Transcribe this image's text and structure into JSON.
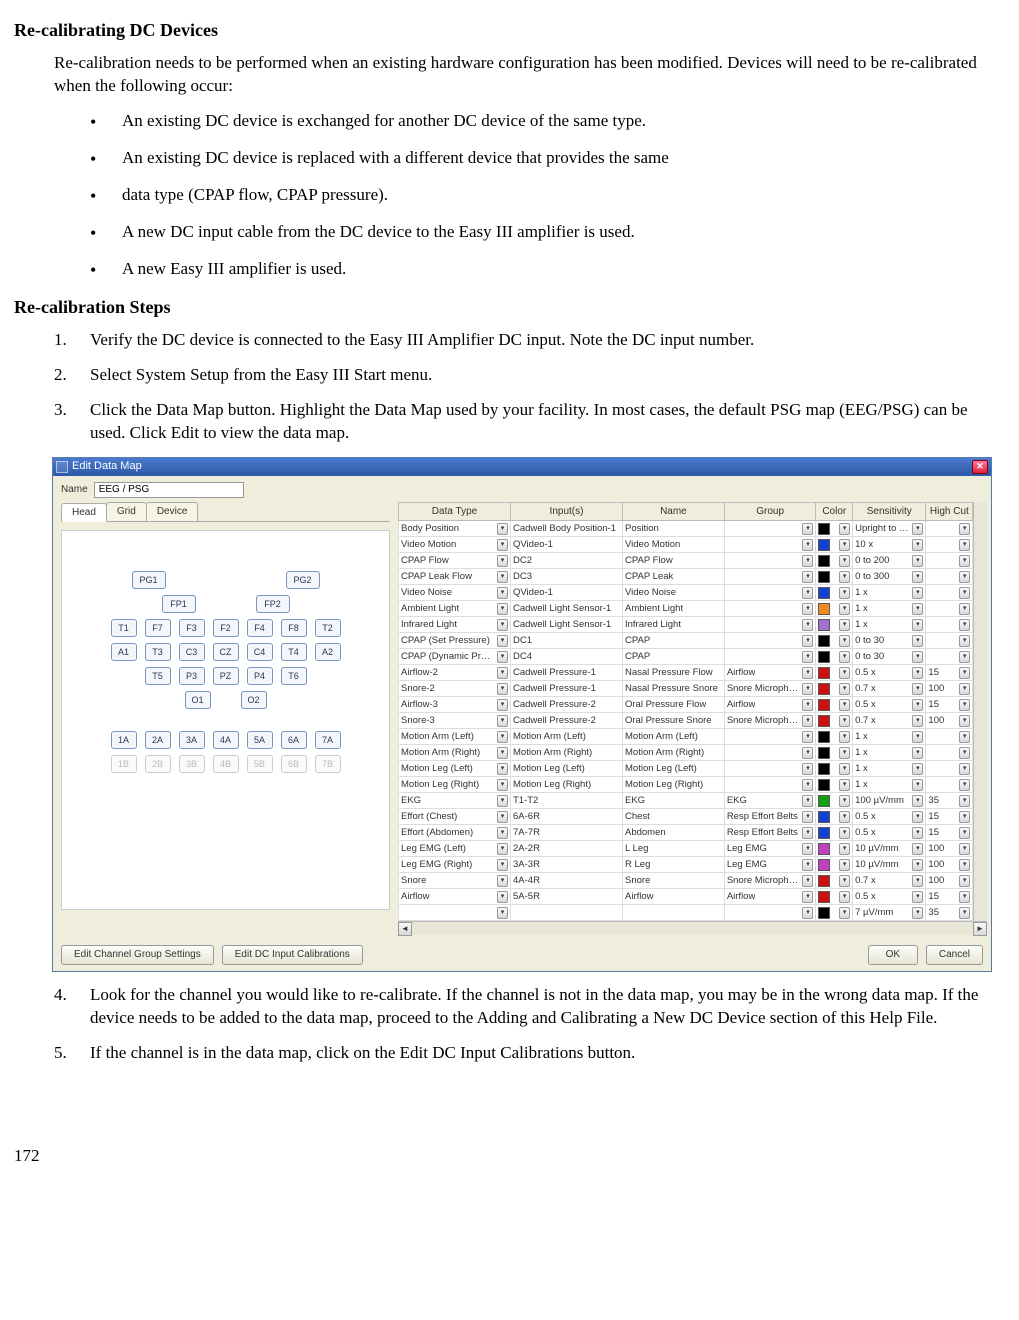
{
  "page_number": "172",
  "h1": "Re-calibrating DC Devices",
  "intro": "Re-calibration needs to be performed when an existing hardware configuration has been modified.  Devices will need to be re-calibrated when the following occur:",
  "bullets": [
    "An existing DC device is exchanged for another DC device of the same type.",
    "An existing DC device is replaced with a different device that provides the same",
    "data type (CPAP flow, CPAP pressure).",
    "A new DC input cable from the DC device to the Easy III amplifier is used.",
    "A new Easy III amplifier is used."
  ],
  "h2": "Re-calibration Steps",
  "steps": [
    "Verify the DC device is connected to the Easy III Amplifier DC input.  Note the DC  input number.",
    "Select System Setup from the Easy III Start menu.",
    "Click the Data Map button.  Highlight the Data Map used by your facility.  In most cases, the default PSG map (EEG/PSG) can be used.  Click Edit to view the data map.",
    "Look for the channel you would like to re-calibrate.  If the channel is not in the data map, you may be in the wrong data map.  If the device needs to be added to the data map, proceed to the Adding and Calibrating a New DC Device section of this Help File.",
    "If the channel is in the data map, click on the Edit DC Input Calibrations button."
  ],
  "win": {
    "title": "Edit Data Map",
    "name_label": "Name",
    "name_value": "EEG / PSG",
    "tabs": [
      "Head",
      "Grid",
      "Device"
    ],
    "headers": [
      "Data Type",
      "Input(s)",
      "Name",
      "Group",
      "Color",
      "Sensitivity",
      "High Cut"
    ],
    "buttons": {
      "edit_group": "Edit Channel Group Settings",
      "edit_dc": "Edit DC Input Calibrations",
      "ok": "OK",
      "cancel": "Cancel"
    },
    "electrodes": {
      "r1": [
        "PG1",
        "PG2"
      ],
      "r2": [
        "FP1",
        "FP2"
      ],
      "r3": [
        "T1",
        "F7",
        "F3",
        "F2",
        "F4",
        "F8",
        "T2"
      ],
      "r4": [
        "A1",
        "T3",
        "C3",
        "CZ",
        "C4",
        "T4",
        "A2"
      ],
      "r5": [
        "T5",
        "P3",
        "PZ",
        "P4",
        "T6"
      ],
      "r6": [
        "O1",
        "O2"
      ],
      "r7": [
        "1A",
        "2A",
        "3A",
        "4A",
        "5A",
        "6A",
        "7A"
      ],
      "r8": [
        "1B",
        "2B",
        "3B",
        "4B",
        "5B",
        "6B",
        "7B"
      ]
    },
    "rows": [
      {
        "dt": "Body Position",
        "in": "Cadwell Body Position-1",
        "nm": "Position",
        "gp": "",
        "col": "#000000",
        "sen": "Upright to Left",
        "hc": ""
      },
      {
        "dt": "Video Motion",
        "in": "QVideo-1",
        "nm": "Video Motion",
        "gp": "",
        "col": "#1040d0",
        "sen": "10 x",
        "hc": ""
      },
      {
        "dt": "CPAP Flow",
        "in": "DC2",
        "nm": "CPAP Flow",
        "gp": "",
        "col": "#000000",
        "sen": "0 to 200",
        "hc": ""
      },
      {
        "dt": "CPAP Leak Flow",
        "in": "DC3",
        "nm": "CPAP Leak",
        "gp": "",
        "col": "#000000",
        "sen": "0 to 300",
        "hc": ""
      },
      {
        "dt": "Video Noise",
        "in": "QVideo-1",
        "nm": "Video Noise",
        "gp": "",
        "col": "#1040d0",
        "sen": "1 x",
        "hc": ""
      },
      {
        "dt": "Ambient Light",
        "in": "Cadwell Light Sensor-1",
        "nm": "Ambient Light",
        "gp": "",
        "col": "#ef8a1f",
        "sen": "1 x",
        "hc": ""
      },
      {
        "dt": "Infrared Light",
        "in": "Cadwell Light Sensor-1",
        "nm": "Infrared Light",
        "gp": "",
        "col": "#a070d0",
        "sen": "1 x",
        "hc": ""
      },
      {
        "dt": "CPAP (Set Pressure)",
        "in": "DC1",
        "nm": "CPAP",
        "gp": "",
        "col": "#000000",
        "sen": "0 to 30",
        "hc": ""
      },
      {
        "dt": "CPAP (Dynamic Pressure)",
        "in": "DC4",
        "nm": "CPAP",
        "gp": "",
        "col": "#000000",
        "sen": "0 to 30",
        "hc": ""
      },
      {
        "dt": "Airflow-2",
        "in": "Cadwell Pressure-1",
        "nm": "Nasal Pressure Flow",
        "gp": "Airflow",
        "col": "#d01010",
        "sen": "0.5 x",
        "hc": "15"
      },
      {
        "dt": "Snore-2",
        "in": "Cadwell Pressure-1",
        "nm": "Nasal Pressure Snore",
        "gp": "Snore Microphone",
        "col": "#d01010",
        "sen": "0.7 x",
        "hc": "100"
      },
      {
        "dt": "Airflow-3",
        "in": "Cadwell Pressure-2",
        "nm": "Oral Pressure Flow",
        "gp": "Airflow",
        "col": "#d01010",
        "sen": "0.5 x",
        "hc": "15"
      },
      {
        "dt": "Snore-3",
        "in": "Cadwell Pressure-2",
        "nm": "Oral Pressure Snore",
        "gp": "Snore Microphone",
        "col": "#d01010",
        "sen": "0.7 x",
        "hc": "100"
      },
      {
        "dt": "Motion Arm (Left)",
        "in": "Motion Arm (Left)",
        "nm": "Motion Arm (Left)",
        "gp": "",
        "col": "#000000",
        "sen": "1 x",
        "hc": ""
      },
      {
        "dt": "Motion Arm (Right)",
        "in": "Motion Arm (Right)",
        "nm": "Motion Arm (Right)",
        "gp": "",
        "col": "#000000",
        "sen": "1 x",
        "hc": ""
      },
      {
        "dt": "Motion Leg (Left)",
        "in": "Motion Leg (Left)",
        "nm": "Motion Leg (Left)",
        "gp": "",
        "col": "#000000",
        "sen": "1 x",
        "hc": ""
      },
      {
        "dt": "Motion Leg (Right)",
        "in": "Motion Leg (Right)",
        "nm": "Motion Leg (Right)",
        "gp": "",
        "col": "#000000",
        "sen": "1 x",
        "hc": ""
      },
      {
        "dt": "EKG",
        "in": "T1-T2",
        "nm": "EKG",
        "gp": "EKG",
        "col": "#10a010",
        "sen": "100 µV/mm",
        "hc": "35"
      },
      {
        "dt": "Effort (Chest)",
        "in": "6A-6R",
        "nm": "Chest",
        "gp": "Resp Effort Belts",
        "col": "#1040d0",
        "sen": "0.5 x",
        "hc": "15"
      },
      {
        "dt": "Effort (Abdomen)",
        "in": "7A-7R",
        "nm": "Abdomen",
        "gp": "Resp Effort Belts",
        "col": "#1040d0",
        "sen": "0.5 x",
        "hc": "15"
      },
      {
        "dt": "Leg EMG (Left)",
        "in": "2A-2R",
        "nm": "L Leg",
        "gp": "Leg EMG",
        "col": "#c040c0",
        "sen": "10 µV/mm",
        "hc": "100"
      },
      {
        "dt": "Leg EMG (Right)",
        "in": "3A-3R",
        "nm": "R Leg",
        "gp": "Leg EMG",
        "col": "#c040c0",
        "sen": "10 µV/mm",
        "hc": "100"
      },
      {
        "dt": "Snore",
        "in": "4A-4R",
        "nm": "Snore",
        "gp": "Snore Microphone",
        "col": "#d01010",
        "sen": "0.7 x",
        "hc": "100"
      },
      {
        "dt": "Airflow",
        "in": "5A-5R",
        "nm": "Airflow",
        "gp": "Airflow",
        "col": "#d01010",
        "sen": "0.5 x",
        "hc": "15"
      },
      {
        "dt": "",
        "in": "",
        "nm": "",
        "gp": "",
        "col": "#000000",
        "sen": "7 µV/mm",
        "hc": "35"
      }
    ]
  }
}
